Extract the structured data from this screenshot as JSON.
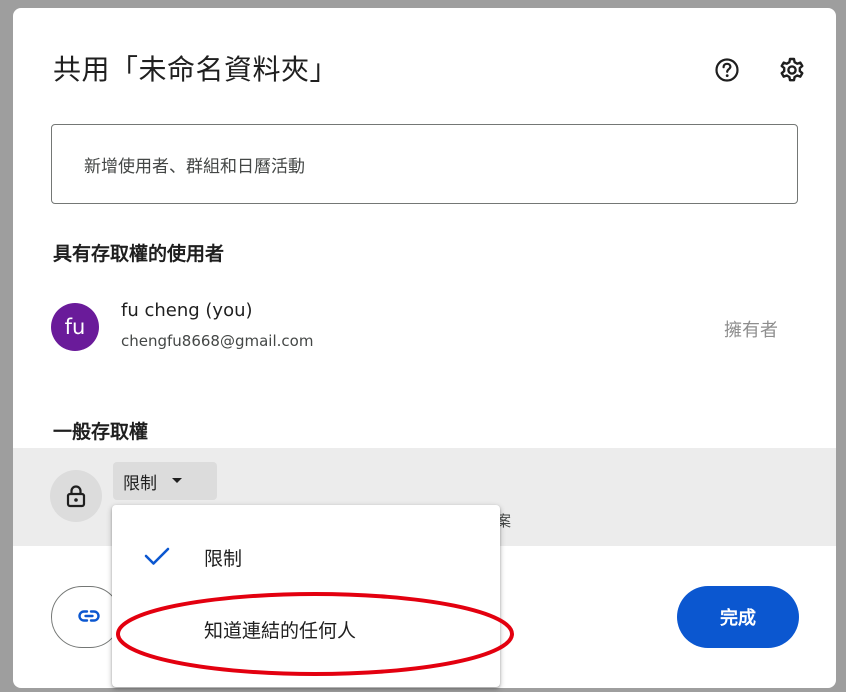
{
  "dialog": {
    "title": "共用「未命名資料夾」",
    "help_icon": "help-circle-icon",
    "settings_icon": "gear-icon"
  },
  "add_people": {
    "placeholder": "新增使用者、群組和日曆活動"
  },
  "people_section": {
    "heading": "具有存取權的使用者",
    "users": [
      {
        "avatar_text": "fu",
        "avatar_color": "#6a1b9a",
        "name": "fu cheng (you)",
        "email": "chengfu8668@gmail.com",
        "role": "擁有者"
      }
    ]
  },
  "general_access": {
    "heading": "一般存取權",
    "lock_icon": "lock-icon",
    "selected": "限制",
    "description_visible_tail": "檔案"
  },
  "access_menu": {
    "options": [
      {
        "label": "限制",
        "checked": true
      },
      {
        "label": "知道連結的任何人",
        "checked": false
      }
    ]
  },
  "footer": {
    "copy_link_icon": "link-icon",
    "done_label": "完成"
  },
  "colors": {
    "primary": "#0b57d0",
    "check": "#0b57d0",
    "annotation": "#e3000f",
    "avatar": "#6a1b9a"
  }
}
